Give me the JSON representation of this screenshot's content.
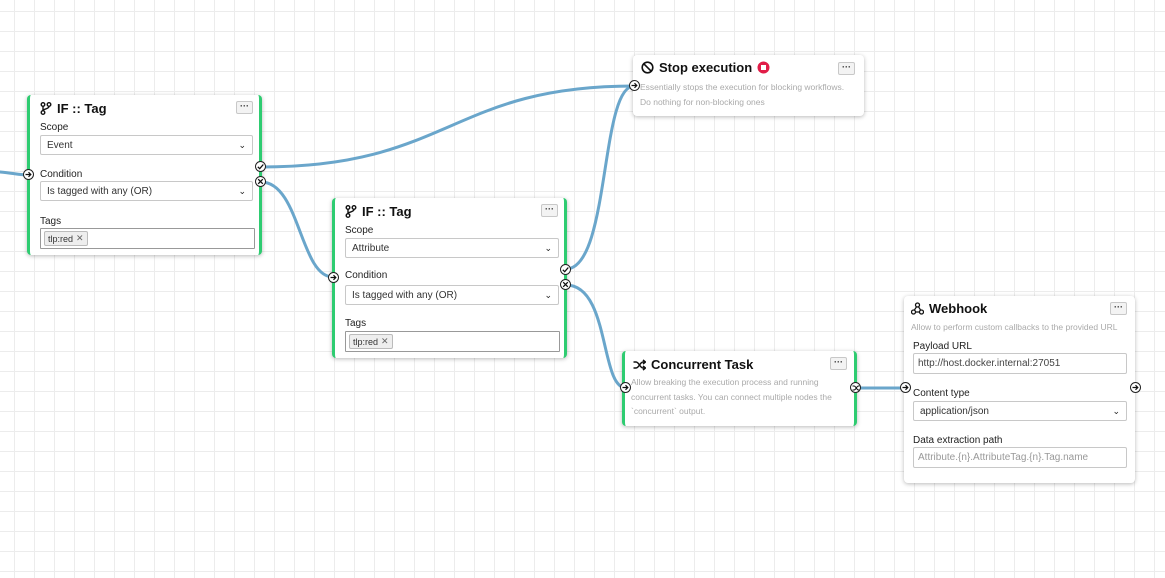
{
  "colors": {
    "edge": "#6aa6cb",
    "active_border": "#2ecc71",
    "stop_icon": "#e11d48"
  },
  "node_if_tag_1": {
    "title": "IF :: Tag",
    "icon": "branch-icon",
    "scope_label": "Scope",
    "scope_value": "Event",
    "condition_label": "Condition",
    "condition_value": "Is tagged with any (OR)",
    "tags_label": "Tags",
    "tags": [
      "tlp:red"
    ],
    "menu_label": "···"
  },
  "node_if_tag_2": {
    "title": "IF :: Tag",
    "icon": "branch-icon",
    "scope_label": "Scope",
    "scope_value": "Attribute",
    "condition_label": "Condition",
    "condition_value": "Is tagged with any (OR)",
    "tags_label": "Tags",
    "tags": [
      "tlp:red"
    ],
    "menu_label": "···"
  },
  "node_stop": {
    "title": "Stop execution",
    "icon": "block-icon",
    "badge_icon": "stop-circle-icon",
    "desc_line1": "Essentially stops the execution for blocking workflows.",
    "desc_line2": "Do nothing for non-blocking ones",
    "menu_label": "···"
  },
  "node_concurrent": {
    "title": "Concurrent Task",
    "icon": "shuffle-icon",
    "desc_line1": "Allow breaking the execution process and running",
    "desc_line2": "concurrent tasks. You can connect multiple nodes the",
    "desc_line3": "`concurrent` output.",
    "menu_label": "···"
  },
  "node_webhook": {
    "title": "Webhook",
    "icon": "webhook-icon",
    "desc": "Allow to perform custom callbacks to the provided URL",
    "payload_label": "Payload URL",
    "payload_value": "http://host.docker.internal:27051",
    "content_type_label": "Content type",
    "content_type_value": "application/json",
    "extraction_label": "Data extraction path",
    "extraction_placeholder": "Attribute.{n}.AttributeTag.{n}.Tag.name",
    "menu_label": "···"
  }
}
